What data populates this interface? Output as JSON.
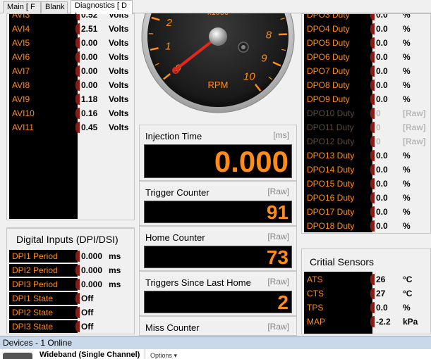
{
  "tabs": [
    {
      "label": "Main [ F ]"
    },
    {
      "label": "Blank"
    },
    {
      "label": "Diagnostics [ D ]"
    }
  ],
  "avi": [
    {
      "label": "AVI3",
      "value": "0.52",
      "unit": "Volts"
    },
    {
      "label": "AVI4",
      "value": "2.51",
      "unit": "Volts"
    },
    {
      "label": "AVI5",
      "value": "0.00",
      "unit": "Volts"
    },
    {
      "label": "AVI6",
      "value": "0.00",
      "unit": "Volts"
    },
    {
      "label": "AVI7",
      "value": "0.00",
      "unit": "Volts"
    },
    {
      "label": "AVI8",
      "value": "0.00",
      "unit": "Volts"
    },
    {
      "label": "AVI9",
      "value": "1.18",
      "unit": "Volts"
    },
    {
      "label": "AVI10",
      "value": "0.16",
      "unit": "Volts"
    },
    {
      "label": "AVI11",
      "value": "0.45",
      "unit": "Volts"
    }
  ],
  "digital": {
    "title": "Digital Inputs (DPI/DSI)",
    "rows": [
      {
        "label": "DPI1 Period",
        "value": "0.000",
        "unit": "ms"
      },
      {
        "label": "DPI2 Period",
        "value": "0.000",
        "unit": "ms"
      },
      {
        "label": "DPI3 Period",
        "value": "0.000",
        "unit": "ms"
      },
      {
        "label": "DPI1 State",
        "value": "Off",
        "unit": ""
      },
      {
        "label": "DPI2 State",
        "value": "Off",
        "unit": ""
      },
      {
        "label": "DPI3 State",
        "value": "Off",
        "unit": ""
      }
    ]
  },
  "gauge": {
    "multiplier": "x1000",
    "label": "RPM",
    "ticks": [
      "0",
      "1",
      "2",
      "8",
      "9",
      "10"
    ],
    "value": 0
  },
  "injection": {
    "title": "Injection Time",
    "unit": "[ms]",
    "value": "0.000"
  },
  "trigger": {
    "title": "Trigger Counter",
    "unit": "[Raw]",
    "value": "91"
  },
  "home": {
    "title": "Home Counter",
    "unit": "[Raw]",
    "value": "73"
  },
  "since_home": {
    "title": "Triggers Since Last Home",
    "unit": "[Raw]",
    "value": "2"
  },
  "miss": {
    "title": "Miss Counter",
    "unit": "[Raw]"
  },
  "dpo": [
    {
      "label": "DPO3 Duty",
      "value": "0.0",
      "unit": "%",
      "dim": false
    },
    {
      "label": "DPO4 Duty",
      "value": "0.0",
      "unit": "%",
      "dim": false
    },
    {
      "label": "DPO5 Duty",
      "value": "0.0",
      "unit": "%",
      "dim": false
    },
    {
      "label": "DPO6 Duty",
      "value": "0.0",
      "unit": "%",
      "dim": false
    },
    {
      "label": "DPO7 Duty",
      "value": "0.0",
      "unit": "%",
      "dim": false
    },
    {
      "label": "DPO8 Duty",
      "value": "0.0",
      "unit": "%",
      "dim": false
    },
    {
      "label": "DPO9 Duty",
      "value": "0.0",
      "unit": "%",
      "dim": false
    },
    {
      "label": "DPO10 Duty",
      "value": "0",
      "unit": "[Raw]",
      "dim": true
    },
    {
      "label": "DPO11 Duty",
      "value": "0",
      "unit": "[Raw]",
      "dim": true
    },
    {
      "label": "DPO12 Duty",
      "value": "0",
      "unit": "[Raw]",
      "dim": true
    },
    {
      "label": "DPO13 Duty",
      "value": "0.0",
      "unit": "%",
      "dim": false
    },
    {
      "label": "DPO14 Duty",
      "value": "0.0",
      "unit": "%",
      "dim": false
    },
    {
      "label": "DPO15 Duty",
      "value": "0.0",
      "unit": "%",
      "dim": false
    },
    {
      "label": "DPO16 Duty",
      "value": "0.0",
      "unit": "%",
      "dim": false
    },
    {
      "label": "DPO17 Duty",
      "value": "0.0",
      "unit": "%",
      "dim": false
    },
    {
      "label": "DPO18 Duty",
      "value": "0.0",
      "unit": "%",
      "dim": false
    }
  ],
  "critical": {
    "title": "Critial Sensors",
    "rows": [
      {
        "label": "ATS",
        "value": "26",
        "unit": "°C"
      },
      {
        "label": "CTS",
        "value": "27",
        "unit": "°C"
      },
      {
        "label": "TPS",
        "value": "0.0",
        "unit": "%"
      },
      {
        "label": "MAP",
        "value": "-2.2",
        "unit": "kPa"
      }
    ]
  },
  "devices": {
    "title": "Devices - 1 Online",
    "device_name": "Wideband (Single Channel)",
    "options_label": "Options ▾"
  },
  "colors": {
    "accent": "#ff8c1a",
    "separator": "#8a1a12",
    "devbar": "#c9d9eb"
  }
}
